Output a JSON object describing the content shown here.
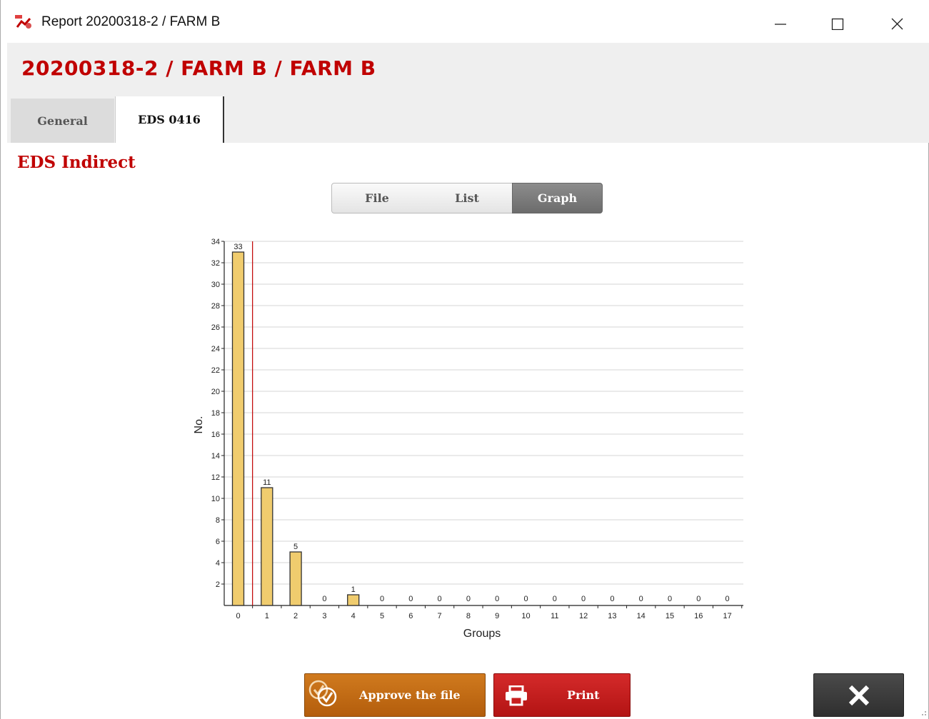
{
  "window": {
    "title": "Report 20200318-2 / FARM B",
    "minimize_icon": "minimize-icon",
    "maximize_icon": "maximize-icon",
    "close_icon": "close-icon"
  },
  "header": {
    "title": "20200318-2 / FARM B / FARM B"
  },
  "tabs": [
    {
      "label": "General",
      "active": false
    },
    {
      "label": "EDS 0416",
      "active": true
    }
  ],
  "section": {
    "title": "EDS Indirect"
  },
  "view_toggle": [
    {
      "label": "File",
      "active": false
    },
    {
      "label": "List",
      "active": false
    },
    {
      "label": "Graph",
      "active": true
    }
  ],
  "chart_data": {
    "type": "bar",
    "categories": [
      "0",
      "1",
      "2",
      "3",
      "4",
      "5",
      "6",
      "7",
      "8",
      "9",
      "10",
      "11",
      "12",
      "13",
      "14",
      "15",
      "16",
      "17"
    ],
    "values": [
      33,
      11,
      5,
      0,
      1,
      0,
      0,
      0,
      0,
      0,
      0,
      0,
      0,
      0,
      0,
      0,
      0,
      0
    ],
    "xlabel": "Groups",
    "ylabel": "No.",
    "ylim": [
      0,
      34
    ],
    "yticks": [
      2,
      4,
      6,
      8,
      10,
      12,
      14,
      16,
      18,
      20,
      22,
      24,
      26,
      28,
      30,
      32,
      34
    ],
    "grid": true,
    "bar_color": "#f0cc6e",
    "bar_edge_color": "#333333",
    "reference_line_color": "#c00000",
    "reference_line_x": 0.5
  },
  "buttons": {
    "approve_label": "Approve the file",
    "print_label": "Print",
    "approve_color": "#c46a14",
    "print_color": "#c81e1e",
    "close_color": "#3a3a3a"
  },
  "colors": {
    "accent_red": "#c00000",
    "header_bg": "#efefef"
  }
}
